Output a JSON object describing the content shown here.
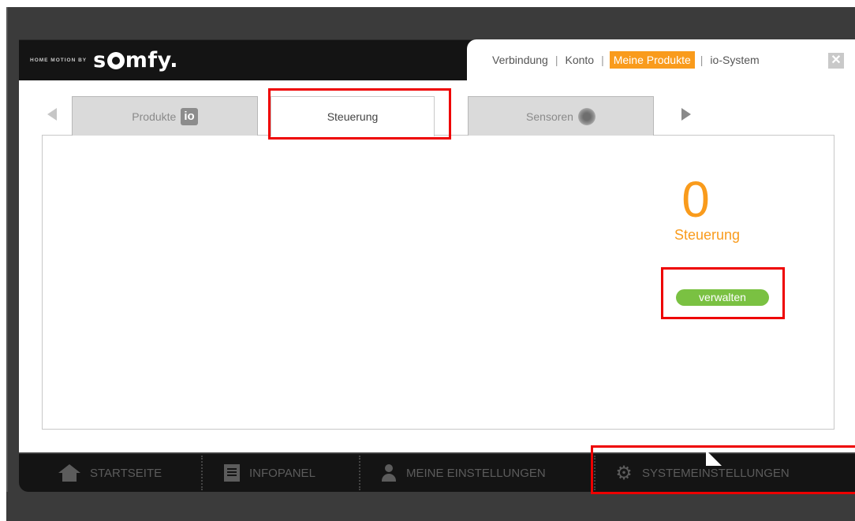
{
  "logo": {
    "tagline": "HOME MOTION BY",
    "brand_left": "s",
    "brand_right": "mfy."
  },
  "topnav": {
    "items": [
      {
        "label": "Verbindung"
      },
      {
        "label": "Konto"
      },
      {
        "label": "Meine Produkte",
        "active": true
      },
      {
        "label": "io-System"
      }
    ],
    "separator": "|",
    "close_label": "✕"
  },
  "tabs": [
    {
      "label": "Produkte",
      "badge": "io"
    },
    {
      "label": "Steuerung",
      "selected": true
    },
    {
      "label": "Sensoren",
      "icon": "sensor-icon"
    }
  ],
  "summary": {
    "count": "0",
    "label": "Steuerung",
    "manage_label": "verwalten"
  },
  "bottomnav": [
    {
      "label": "STARTSEITE",
      "icon": "home-icon"
    },
    {
      "label": "INFOPANEL",
      "icon": "document-icon"
    },
    {
      "label": "MEINE EINSTELLUNGEN",
      "icon": "user-icon"
    },
    {
      "label": "SYSTEMEINSTELLUNGEN",
      "icon": "gear-icon"
    }
  ],
  "colors": {
    "accent_orange": "#f99b1c",
    "button_green": "#7ac142",
    "highlight_red": "#ee0000",
    "bar_dark": "#141414"
  },
  "gear_glyph": "⚙"
}
